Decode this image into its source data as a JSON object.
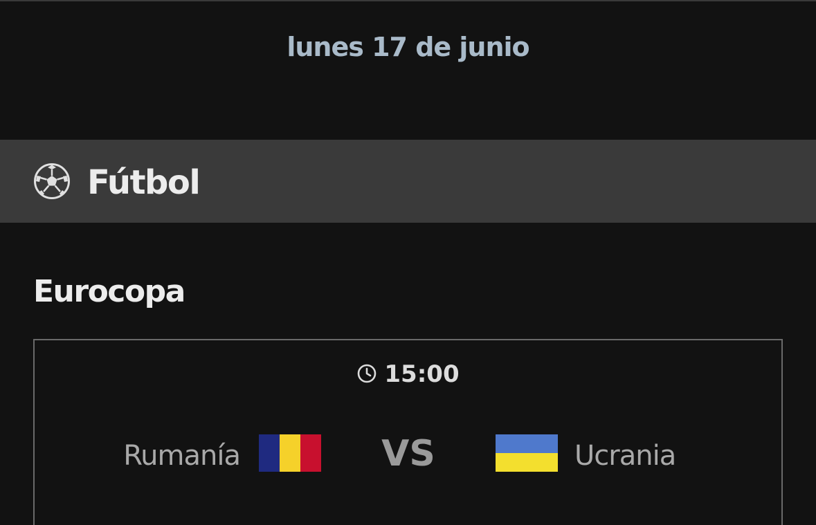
{
  "date": "lunes 17 de junio",
  "sport": {
    "label": "Fútbol",
    "icon": "soccer-ball-icon"
  },
  "competition": "Eurocopa",
  "match": {
    "time": "15:00",
    "time_icon": "clock-icon",
    "home_team": "Rumanía",
    "home_flag": "romania-flag-icon",
    "vs_label": "VS",
    "away_team": "Ucrania",
    "away_flag": "ukraine-flag-icon"
  },
  "colors": {
    "background": "#121212",
    "sport_bar": "#3a3a3a",
    "date_text": "#a9bac9",
    "ro_blue": "#1f2a80",
    "ro_yellow": "#f5d12a",
    "ro_red": "#c8102e",
    "ua_blue": "#4f79cc",
    "ua_yellow": "#f3df2e"
  }
}
